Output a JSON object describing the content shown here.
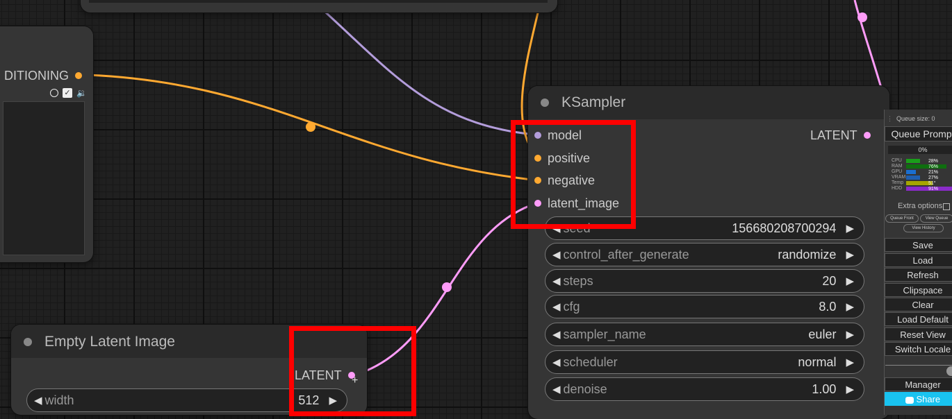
{
  "conditioning_node": {
    "output_label": "DITIONING",
    "icons": [
      "circle-outline-icon",
      "checkbox-checked-icon",
      "speaker-icon"
    ]
  },
  "ksampler": {
    "title": "KSampler",
    "inputs": [
      {
        "label": "model",
        "color": "#b39ddb"
      },
      {
        "label": "positive",
        "color": "#ffa931"
      },
      {
        "label": "negative",
        "color": "#ffa931"
      },
      {
        "label": "latent_image",
        "color": "#ff9cf9"
      }
    ],
    "output": {
      "label": "LATENT",
      "color": "#ff9cf9"
    },
    "widgets": [
      {
        "label": "seed",
        "value": "156680208700294"
      },
      {
        "label": "control_after_generate",
        "value": "randomize"
      },
      {
        "label": "steps",
        "value": "20"
      },
      {
        "label": "cfg",
        "value": "8.0"
      },
      {
        "label": "sampler_name",
        "value": "euler"
      },
      {
        "label": "scheduler",
        "value": "normal"
      },
      {
        "label": "denoise",
        "value": "1.00"
      }
    ]
  },
  "empty_latent": {
    "title": "Empty Latent Image",
    "output_label": "LATENT",
    "widget": {
      "label": "width",
      "value": "512"
    }
  },
  "side_panel": {
    "queue_size": "Queue size: 0",
    "queue_prompt": "Queue Prompt",
    "progress": "0%",
    "stats": [
      {
        "label": "CPU",
        "pct": "28%",
        "value": 0.28,
        "color": "#1a9e1a"
      },
      {
        "label": "RAM",
        "pct": "76%",
        "value": 0.76,
        "color": "#0f6e0f"
      },
      {
        "label": "GPU",
        "pct": "21%",
        "value": 0.21,
        "color": "#1a6fd1"
      },
      {
        "label": "VRAM",
        "pct": "27%",
        "value": 0.27,
        "color": "#1f5fb0"
      },
      {
        "label": "Temp",
        "pct": "51°",
        "value": 0.51,
        "color": "#a6a600"
      },
      {
        "label": "HDD",
        "pct": "91%",
        "value": 0.91,
        "color": "#8a2bc9"
      }
    ],
    "extra_options": "Extra options",
    "queue_front": "Queue Front",
    "view_queue": "View Queue",
    "view_history": "View History",
    "buttons": [
      "Save",
      "Load",
      "Refresh",
      "Clipspace",
      "Clear",
      "Load Default",
      "Reset View",
      "Switch Locale"
    ],
    "manager": "Manager",
    "share": "Share"
  }
}
